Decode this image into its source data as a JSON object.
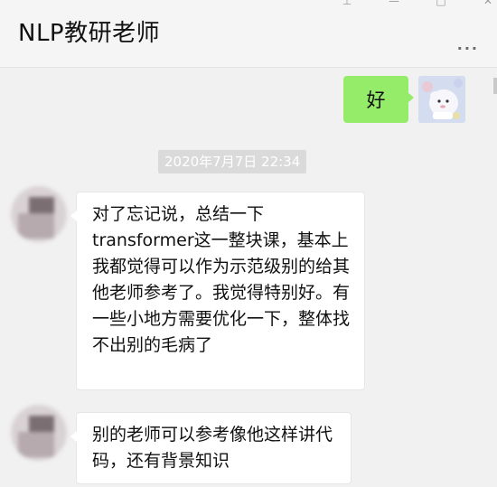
{
  "window": {
    "controls": [
      "pin-icon",
      "minimize-icon",
      "maximize-icon",
      "close-icon"
    ],
    "title": "NLP教研老师",
    "more_label": "..."
  },
  "messages": {
    "outgoing": {
      "text": "好",
      "bubble_color": "#95ec69"
    },
    "timestamp": "2020年7月7日 22:34",
    "incoming": [
      {
        "text": "对了忘记说，总结一下\ntransformer这一整块课，基本上我都觉得可以作为示范级别的给其他老师参考了。我觉得特别好。有一些小地方需要优化一下，整体找不出别的毛病了"
      },
      {
        "text": "别的老师可以参考像他这样讲代码，还有背景知识"
      }
    ]
  }
}
